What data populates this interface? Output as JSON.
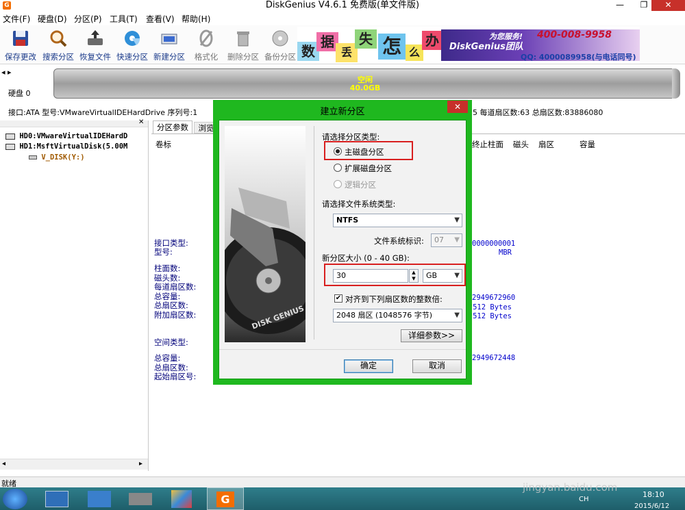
{
  "window": {
    "title": "DiskGenius V4.6.1 免费版(单文件版)",
    "app_icon": "G"
  },
  "menu": [
    "文件(F)",
    "硬盘(D)",
    "分区(P)",
    "工具(T)",
    "查看(V)",
    "帮助(H)"
  ],
  "toolbar": [
    {
      "label": "保存更改",
      "icon": "save-icon"
    },
    {
      "label": "搜索分区",
      "icon": "search-icon"
    },
    {
      "label": "恢复文件",
      "icon": "recover-icon"
    },
    {
      "label": "快速分区",
      "icon": "quick-partition-icon"
    },
    {
      "label": "新建分区",
      "icon": "new-partition-icon"
    },
    {
      "label": "格式化",
      "icon": "format-icon"
    },
    {
      "label": "删除分区",
      "icon": "delete-icon"
    },
    {
      "label": "备份分区",
      "icon": "backup-icon"
    }
  ],
  "banner": {
    "tiles": [
      "数",
      "据",
      "丢",
      "失",
      "怎",
      "么",
      "办"
    ],
    "brand": "DiskGenius团队",
    "service": "为您服务!",
    "phone": "400-008-9958",
    "qq": "QQ: 4000089958(与电话同号)"
  },
  "disk": {
    "label": "硬盘 0",
    "free_label": "空闲",
    "free_size": "40.0GB",
    "info_left": "接口:ATA  型号:VMwareVirtualIDEHardDrive  序列号:1",
    "info_right": "5  每道扇区数:63  总扇区数:83886080"
  },
  "tree": [
    "HD0:VMwareVirtualIDEHardD",
    "HD1:MsftVirtualDisk(5.00M",
    "V_DISK(Y:)"
  ],
  "tabs": [
    "分区参数",
    "浏览"
  ],
  "table_headers": [
    "卷标",
    "终止柱面",
    "磁头",
    "扇区",
    "容量"
  ],
  "details": {
    "labels_a": [
      "接口类型:",
      "型号:"
    ],
    "labels_b": [
      "柱面数:",
      "磁头数:",
      "每道扇区数:",
      "总容量:",
      "总扇区数:",
      "附加扇区数:"
    ],
    "labels_c": [
      "空间类型:"
    ],
    "labels_d": [
      "总容量:",
      "总扇区数:",
      "起始扇区号:"
    ],
    "values_a": [
      "0000000001",
      "MBR"
    ],
    "values_b": [
      "2949672960",
      "512 Bytes",
      "512 Bytes"
    ],
    "values_d": [
      "2949672448"
    ]
  },
  "status": "就绪",
  "dialog": {
    "title": "建立新分区",
    "close": "✕",
    "select_type_label": "请选择分区类型:",
    "type_primary": "主磁盘分区",
    "type_extended": "扩展磁盘分区",
    "type_logical": "逻辑分区",
    "fs_label": "请选择文件系统类型:",
    "fs_value": "NTFS",
    "fs_id_label": "文件系统标识:",
    "fs_id_value": "07",
    "size_label": "新分区大小 (0 - 40 GB):",
    "size_value": "30",
    "size_unit": "GB",
    "align_label": "对齐到下列扇区数的整数倍:",
    "align_value": "2048 扇区 (1048576 字节)",
    "advanced_button": "详细参数>>",
    "ok_button": "确定",
    "cancel_button": "取消",
    "brand_image_text": "DISK GENIUS"
  },
  "taskbar": {
    "lang": "CH",
    "time": "18:10",
    "date": "2015/6/12"
  },
  "watermark": {
    "logo": "Bai du 经验",
    "url": "jingyan.baidu.com"
  }
}
